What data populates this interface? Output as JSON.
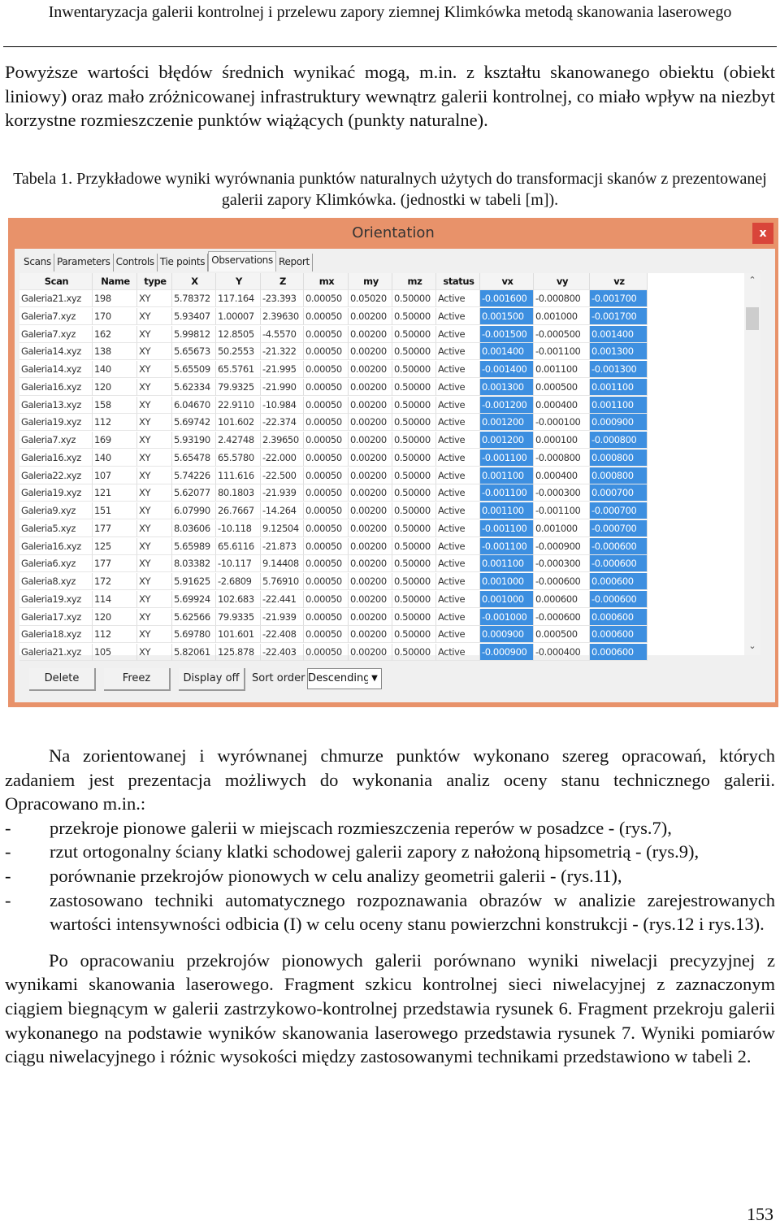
{
  "header": {
    "title": "Inwentaryzacja galerii kontrolnej i przelewu zapory ziemnej Klimkówka metodą skanowania laserowego"
  },
  "intro_paragraph": "Powyższe wartości błędów średnich wynikać mogą, m.in. z kształtu skanowanego obiektu (obiekt liniowy) oraz mało zróżnicowanej infrastruktury wewnątrz galerii kontrolnej, co miało wpływ na niezbyt korzystne rozmieszczenie punktów wiążących (punkty naturalne).",
  "table_caption": "Tabela 1. Przykładowe wyniki wyrównania punktów naturalnych  użytych do transformacji skanów z prezentowanej galerii zapory Klimkówka. (jednostki w tabeli [m]).",
  "window": {
    "title": "Orientation",
    "close_label": "x",
    "tabs": [
      "Scans",
      "Parameters",
      "Controls",
      "Tie points",
      "Observations",
      "Report"
    ],
    "active_tab": "Observations",
    "columns": [
      "Scan",
      "Name",
      "type",
      "X",
      "Y",
      "Z",
      "mx",
      "my",
      "mz",
      "status",
      "vx",
      "vy",
      "vz"
    ],
    "rows": [
      [
        "Galeria21.xyz",
        "198",
        "XY",
        "5.78372",
        "117.164",
        "-23.393",
        "0.00050",
        "0.05020",
        "0.50000",
        "Active",
        "-0.001600",
        "-0.000800",
        "-0.001700"
      ],
      [
        "Galeria7.xyz",
        "170",
        "XY",
        "5.93407",
        "1.00007",
        "2.39630",
        "0.00050",
        "0.00200",
        "0.50000",
        "Active",
        "0.001500",
        "0.001000",
        "-0.001700"
      ],
      [
        "Galeria7.xyz",
        "162",
        "XY",
        "5.99812",
        "12.8505",
        "-4.5570",
        "0.00050",
        "0.00200",
        "0.50000",
        "Active",
        "-0.001500",
        "-0.000500",
        "0.001400"
      ],
      [
        "Galeria14.xyz",
        "138",
        "XY",
        "5.65673",
        "50.2553",
        "-21.322",
        "0.00050",
        "0.00200",
        "0.50000",
        "Active",
        "0.001400",
        "-0.001100",
        "0.001300"
      ],
      [
        "Galeria14.xyz",
        "140",
        "XY",
        "5.65509",
        "65.5761",
        "-21.995",
        "0.00050",
        "0.00200",
        "0.50000",
        "Active",
        "-0.001400",
        "0.001100",
        "-0.001300"
      ],
      [
        "Galeria16.xyz",
        "120",
        "XY",
        "5.62334",
        "79.9325",
        "-21.990",
        "0.00050",
        "0.00200",
        "0.50000",
        "Active",
        "0.001300",
        "0.000500",
        "0.001100"
      ],
      [
        "Galeria13.xyz",
        "158",
        "XY",
        "6.04670",
        "22.9110",
        "-10.984",
        "0.00050",
        "0.00200",
        "0.50000",
        "Active",
        "-0.001200",
        "0.000400",
        "0.001100"
      ],
      [
        "Galeria19.xyz",
        "112",
        "XY",
        "5.69742",
        "101.602",
        "-22.374",
        "0.00050",
        "0.00200",
        "0.50000",
        "Active",
        "0.001200",
        "-0.000100",
        "0.000900"
      ],
      [
        "Galeria7.xyz",
        "169",
        "XY",
        "5.93190",
        "2.42748",
        "2.39650",
        "0.00050",
        "0.00200",
        "0.50000",
        "Active",
        "0.001200",
        "0.000100",
        "-0.000800"
      ],
      [
        "Galeria16.xyz",
        "140",
        "XY",
        "5.65478",
        "65.5780",
        "-22.000",
        "0.00050",
        "0.00200",
        "0.50000",
        "Active",
        "-0.001100",
        "-0.000800",
        "0.000800"
      ],
      [
        "Galeria22.xyz",
        "107",
        "XY",
        "5.74226",
        "111.616",
        "-22.500",
        "0.00050",
        "0.00200",
        "0.50000",
        "Active",
        "0.001100",
        "0.000400",
        "0.000800"
      ],
      [
        "Galeria19.xyz",
        "121",
        "XY",
        "5.62077",
        "80.1803",
        "-21.939",
        "0.00050",
        "0.00200",
        "0.50000",
        "Active",
        "-0.001100",
        "-0.000300",
        "0.000700"
      ],
      [
        "Galeria9.xyz",
        "151",
        "XY",
        "6.07990",
        "26.7667",
        "-14.264",
        "0.00050",
        "0.00200",
        "0.50000",
        "Active",
        "0.001100",
        "-0.001100",
        "-0.000700"
      ],
      [
        "Galeria5.xyz",
        "177",
        "XY",
        "8.03606",
        "-10.118",
        "9.12504",
        "0.00050",
        "0.00200",
        "0.50000",
        "Active",
        "-0.001100",
        "0.001000",
        "-0.000700"
      ],
      [
        "Galeria16.xyz",
        "125",
        "XY",
        "5.65989",
        "65.6116",
        "-21.873",
        "0.00050",
        "0.00200",
        "0.50000",
        "Active",
        "-0.001100",
        "-0.000900",
        "-0.000600"
      ],
      [
        "Galeria6.xyz",
        "177",
        "XY",
        "8.03382",
        "-10.117",
        "9.14408",
        "0.00050",
        "0.00200",
        "0.50000",
        "Active",
        "0.001100",
        "-0.000300",
        "-0.000600"
      ],
      [
        "Galeria8.xyz",
        "172",
        "XY",
        "5.91625",
        "-2.6809",
        "5.76910",
        "0.00050",
        "0.00200",
        "0.50000",
        "Active",
        "0.001000",
        "-0.000600",
        "0.000600"
      ],
      [
        "Galeria19.xyz",
        "114",
        "XY",
        "5.69924",
        "102.683",
        "-22.441",
        "0.00050",
        "0.00200",
        "0.50000",
        "Active",
        "0.001000",
        "0.000600",
        "-0.000600"
      ],
      [
        "Galeria17.xyz",
        "120",
        "XY",
        "5.62566",
        "79.9335",
        "-21.939",
        "0.00050",
        "0.00200",
        "0.50000",
        "Active",
        "-0.001000",
        "-0.000600",
        "0.000600"
      ],
      [
        "Galeria18.xyz",
        "112",
        "XY",
        "5.69780",
        "101.601",
        "-22.408",
        "0.00050",
        "0.00200",
        "0.50000",
        "Active",
        "0.000900",
        "0.000500",
        "0.000600"
      ],
      [
        "Galeria21.xyz",
        "105",
        "XY",
        "5.82061",
        "125.878",
        "-22.403",
        "0.00050",
        "0.00200",
        "0.50000",
        "Active",
        "-0.000900",
        "-0.000400",
        "0.000600"
      ]
    ],
    "buttons": {
      "delete": "Delete",
      "freez": "Freez",
      "display_off": "Display off"
    },
    "sort_order_label": "Sort order",
    "sort_order_value": "Descending",
    "colors": {
      "frame": "#e8926a",
      "selection": "#3d8fe0",
      "close": "#d9453a"
    }
  },
  "body": {
    "p1": "Na zorientowanej i wyrównanej chmurze punktów wykonano szereg opracowań, których zadaniem jest prezentacja możliwych do wykonania analiz oceny stanu technicznego galerii. Opracowano m.in.:",
    "list": [
      "przekroje pionowe galerii w miejscach rozmieszczenia reperów w posadzce - (rys.7),",
      "rzut ortogonalny ściany klatki schodowej galerii zapory z nałożoną hipsometrią - (rys.9),",
      "porównanie przekrojów pionowych w celu analizy geometrii galerii - (rys.11),",
      "zastosowano techniki automatycznego rozpoznawania obrazów w analizie zarejestrowanych wartości intensywności odbicia (I) w celu oceny stanu powierzchni konstrukcji - (rys.12 i rys.13)."
    ],
    "list_marker": "-",
    "p2": "Po opracowaniu przekrojów pionowych galerii porównano wyniki niwelacji precyzyjnej z wynikami skanowania laserowego. Fragment szkicu kontrolnej sieci niwelacyjnej z zaznaczonym ciągiem biegnącym w galerii zastrzykowo-kontrolnej przedstawia rysunek 6. Fragment przekroju galerii wykonanego na podstawie wyników skanowania laserowego przedstawia rysunek 7. Wyniki pomiarów ciągu niwelacyjnego i różnic wysokości między zastosowanymi technikami przedstawiono w tabeli 2."
  },
  "page_number": "153"
}
